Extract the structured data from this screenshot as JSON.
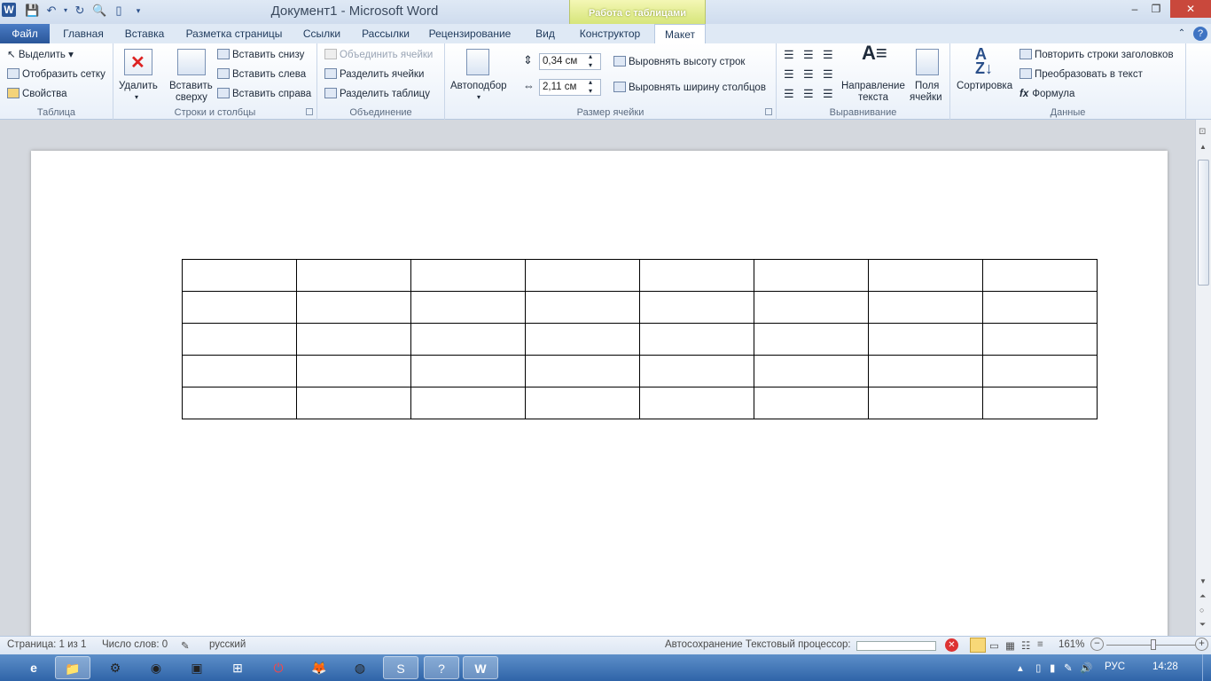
{
  "title_bar": {
    "title": "Документ1  -  Microsoft Word",
    "contextual_tab_group": "Работа с таблицами",
    "minimize": "‒",
    "restore": "❐",
    "close": "✕"
  },
  "tabs": [
    {
      "label": "Файл"
    },
    {
      "label": "Главная"
    },
    {
      "label": "Вставка"
    },
    {
      "label": "Разметка страницы"
    },
    {
      "label": "Ссылки"
    },
    {
      "label": "Рассылки"
    },
    {
      "label": "Рецензирование"
    },
    {
      "label": "Вид"
    },
    {
      "label": "Конструктор"
    },
    {
      "label": "Макет"
    }
  ],
  "ribbon": {
    "table": {
      "select": "Выделить",
      "gridlines": "Отобразить сетку",
      "properties": "Свойства",
      "label": "Таблица"
    },
    "rows_cols": {
      "delete": "Удалить",
      "insert_above_1": "Вставить",
      "insert_above_2": "сверху",
      "insert_below": "Вставить снизу",
      "insert_left": "Вставить слева",
      "insert_right": "Вставить справа",
      "label": "Строки и столбцы"
    },
    "merge": {
      "merge_cells": "Объединить ячейки",
      "split_cells": "Разделить ячейки",
      "split_table": "Разделить таблицу",
      "label": "Объединение"
    },
    "cell_size": {
      "autofit": "Автоподбор",
      "height": "0,34 см",
      "width": "2,11 см",
      "distribute_rows": "Выровнять высоту строк",
      "distribute_cols": "Выровнять ширину столбцов",
      "label": "Размер ячейки"
    },
    "alignment": {
      "text_direction_1": "Направление",
      "text_direction_2": "текста",
      "margins_1": "Поля",
      "margins_2": "ячейки",
      "label": "Выравнивание"
    },
    "data": {
      "sort": "Сортировка",
      "repeat_header": "Повторить строки заголовков",
      "convert": "Преобразовать в текст",
      "formula": "Формула",
      "label": "Данные"
    }
  },
  "document": {
    "table": {
      "rows": 5,
      "cols": 8
    }
  },
  "status_bar": {
    "page": "Страница: 1 из 1",
    "words": "Число слов: 0",
    "language": "русский",
    "autosave": "Автосохранение Текстовый процессор:",
    "zoom": "161%",
    "zoom_out": "−",
    "zoom_in": "+"
  },
  "taskbar": {
    "lang": "РУС",
    "time": "14:28"
  }
}
